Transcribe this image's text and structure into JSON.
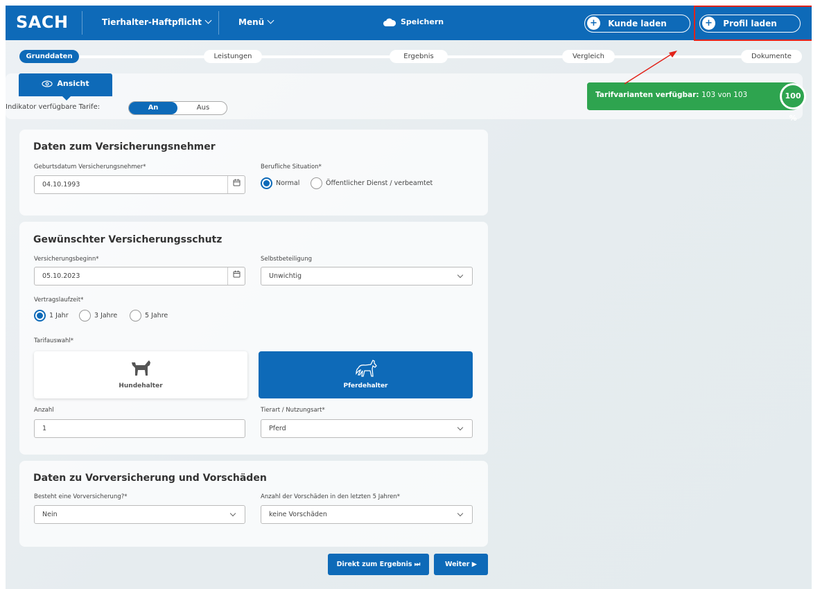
{
  "topbar": {
    "logo": "SACH",
    "product": "Tierhalter-Haftpflicht",
    "menu": "Menü",
    "save": "Speichern",
    "load_customer": "Kunde laden",
    "load_profile": "Profil laden"
  },
  "steps": [
    "Grunddaten",
    "Leistungen",
    "Ergebnis",
    "Vergleich",
    "Dokumente"
  ],
  "filter": {
    "view_tab": "Ansicht",
    "indicator_label": "Indikator verfügbare Tarife:",
    "toggle_on": "An",
    "toggle_off": "Aus",
    "available_label": "Tarifvarianten verfügbar:",
    "available_value": "103 von 103",
    "available_percent": "100 %"
  },
  "section1": {
    "title": "Daten zum Versicherungsnehmer",
    "birth_label": "Geburtsdatum Versicherungsnehmer*",
    "birth_value": "04.10.1993",
    "job_label": "Berufliche Situation*",
    "job_opt1": "Normal",
    "job_opt2": "Öffentlicher Dienst / verbeamtet"
  },
  "section2": {
    "title": "Gewünschter Versicherungsschutz",
    "start_label": "Versicherungsbeginn*",
    "start_value": "05.10.2023",
    "deductible_label": "Selbstbeteiligung",
    "deductible_value": "Unwichtig",
    "term_label": "Vertragslaufzeit*",
    "term_opt1": "1 Jahr",
    "term_opt2": "3 Jahre",
    "term_opt3": "5 Jahre",
    "tariff_label": "Tarifauswahl*",
    "tile_dog": "Hundehalter",
    "tile_horse": "Pferdehalter",
    "count_label": "Anzahl",
    "count_value": "1",
    "animal_label": "Tierart / Nutzungsart*",
    "animal_value": "Pferd"
  },
  "section3": {
    "title": "Daten zu Vorversicherung und Vorschäden",
    "prev_label": "Besteht eine Vorversicherung?*",
    "prev_value": "Nein",
    "claims_label": "Anzahl der Vorschäden in den letzten 5 Jahren*",
    "claims_value": "keine Vorschäden"
  },
  "actions": {
    "direct": "Direkt zum Ergebnis ⏭",
    "next": "Weiter ▶"
  },
  "colors": {
    "primary": "#0e6ab8",
    "available_green": "#2ea44f",
    "highlight_red": "#e2231a"
  }
}
